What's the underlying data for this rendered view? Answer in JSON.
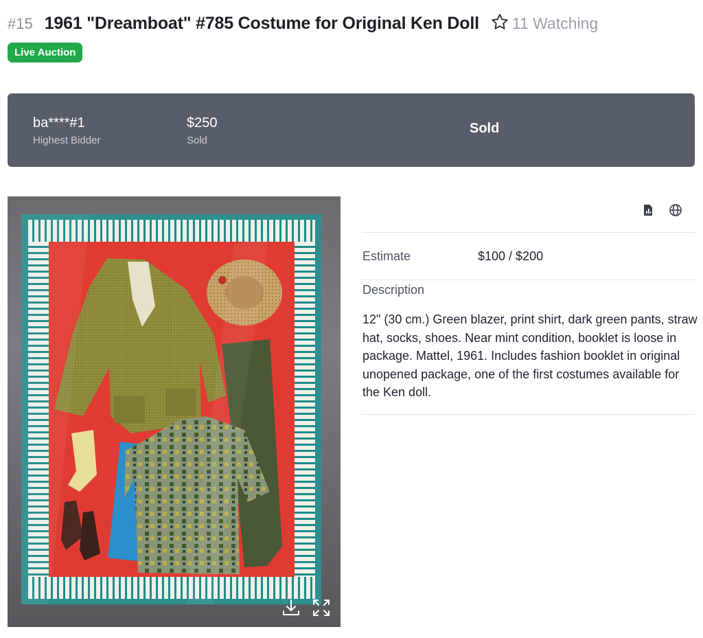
{
  "lot": {
    "number": "#15",
    "title": "1961 \"Dreamboat\" #785 Costume for Original Ken Doll",
    "watching": "11 Watching",
    "badge": "Live Auction"
  },
  "bid_panel": {
    "bidder_value": "ba****#1",
    "bidder_label": "Highest Bidder",
    "price_value": "$250",
    "price_label": "Sold",
    "status": "Sold"
  },
  "details": {
    "estimate_label": "Estimate",
    "estimate_value": "$100 / $200",
    "description_label": "Description",
    "description_text": "12\" (30 cm.) Green blazer, print shirt, dark green pants, straw hat, socks, shoes. Near mint condition, booklet is loose in package. Mattel, 1961. Includes fashion booklet in original unopened package, one of the first costumes available for the Ken doll."
  },
  "icons": {
    "watch": "star-outline-icon",
    "report": "chart-document-icon",
    "language": "globe-icon",
    "download": "download-icon",
    "fullscreen": "expand-icon"
  },
  "colors": {
    "badge_green": "#22a94a",
    "panel_gray": "#575e69"
  }
}
